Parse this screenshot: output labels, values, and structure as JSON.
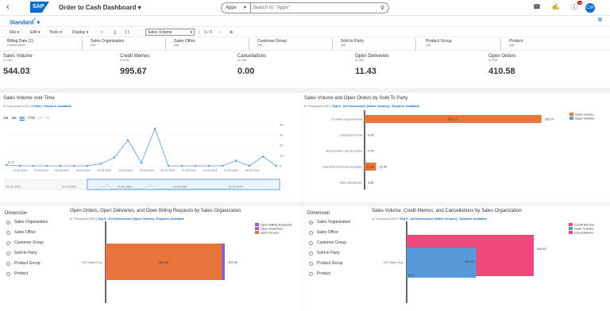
{
  "shell": {
    "back_icon": "back-chevron-icon",
    "logo": "SAP",
    "title": "Order to Cash Dashboard",
    "title_chevron": "▾",
    "search_scope": "Apps",
    "search_placeholder": "Search In: \"Apps\"",
    "notifications_count": "18",
    "avatar_initials": "CJP"
  },
  "variant": {
    "label": "Standard",
    "modified": "*"
  },
  "toolbar": {
    "file": "File",
    "edit": "Edit",
    "tools": "Tools",
    "display": "Display",
    "measure": "Sales Volume",
    "page": "1 / 3"
  },
  "filters": [
    {
      "label": "Billing Date (1)",
      "value": "Current Month"
    },
    {
      "label": "Sales Organization",
      "value": "(All)"
    },
    {
      "label": "Sales Office",
      "value": "(All)"
    },
    {
      "label": "Customer Group",
      "value": "(All)"
    },
    {
      "label": "Sold-to Party",
      "value": "(All)"
    },
    {
      "label": "Product Group",
      "value": "(All)"
    },
    {
      "label": "Product",
      "value": "(All)"
    }
  ],
  "kpis": [
    {
      "title": "Sales Volume",
      "unit": "In USD",
      "value": "544.03"
    },
    {
      "title": "Credit Memos",
      "unit": "In USD",
      "value": "995.67"
    },
    {
      "title": "Cancellations",
      "unit": "In USD",
      "value": "0.00"
    },
    {
      "title": "Open Deliveries",
      "unit": "In USD",
      "value": "11.43"
    },
    {
      "title": "Open Orders",
      "unit": "In USD",
      "value": "410.58"
    }
  ],
  "line_card": {
    "title": "Sales Volume over Time",
    "unit": "In Thousand USD",
    "filter_link": "1 Filter",
    "explorer_link": "Explorer Available",
    "ranges": [
      "1M",
      "3M",
      "6M",
      "YTD",
      "1Y",
      "All"
    ]
  },
  "bar_card": {
    "title": "Sales Volume and Open Orders by Sold-To Party",
    "unit": "In Thousand USD",
    "top_link": "Top 5 - All Dimensions (Sales Volume)",
    "explorer_link": "Explorer Available"
  },
  "dimension_left": {
    "title": "Dimension",
    "options": [
      "Sales Organization",
      "Sales Office",
      "Customer Group",
      "Sold-to Party",
      "Product Group",
      "Product"
    ],
    "selected": 0
  },
  "open_card": {
    "title": "Open Orders, Open Deliveries, and Open Billing Requests by Sales Organization",
    "unit": "In Thousand USD",
    "top_link": "Top 5 - All Dimensions (Open Orders)",
    "explorer_link": "Explorer Available"
  },
  "dimension_right": {
    "title": "Dimension",
    "options": [
      "Sales Organization",
      "Sales Office",
      "Customer Group",
      "Sold-to Party",
      "Product Group",
      "Product"
    ],
    "selected": 0
  },
  "credit_card": {
    "title": "Sales Volume, Credit Memos, and Cancellations by Sales Organization",
    "unit": "In Thousand USD",
    "top_link": "Top 5 - All Dimensions (Sales Volume)",
    "explorer_link": "Explorer Available"
  },
  "colors": {
    "brand": "#0a6ed1",
    "line": "#5899da",
    "orange": "#e8743b",
    "purple": "#945ecf",
    "red": "#ed4a7b",
    "blue": "#5899da"
  },
  "chart_data": [
    {
      "type": "line",
      "x": [
        "12.03.2024",
        "19.03.2024",
        "26.03.2024",
        "02.04.2024",
        "09.04.2024",
        "16.04.2024",
        "23.04.2024",
        "30.04.2024",
        "07.05.2024",
        "14.05.2024",
        "21.05.2024",
        "28.05.2024",
        "04.06.2024",
        "11.06.2024",
        "18.06.2024",
        "25.06.2024",
        "02.07.2024",
        "09.07.2024",
        "16.07.2024",
        "23.07.2024",
        "30.07.2024"
      ],
      "series": [
        {
          "values": [
            0.77,
            0,
            0,
            0,
            0,
            0,
            0,
            2,
            8,
            25,
            3,
            36,
            0,
            0,
            0,
            0,
            0,
            5,
            0,
            9,
            0
          ]
        }
      ],
      "xticks": [
        "12.03.2024",
        "19.03.2024",
        "26.03.2024",
        "02.04.2024",
        "09.04.2024",
        "16.04.2024",
        "23.04.2024",
        "30.04.2024",
        "07.05.2024",
        "14.05.2024",
        "21.05.2024",
        "28.05.2024"
      ],
      "ylim": [
        0,
        40
      ],
      "yticks": [
        "0",
        "10",
        "20",
        "30",
        "40"
      ],
      "point_label": "0.77",
      "range_dates": [
        "01.01.2024",
        "01.03.2024",
        "01.05.2024",
        "01.06.2024",
        "01.07.2024"
      ]
    },
    {
      "type": "bar",
      "categories": [
        "Crowley Supermarket",
        "Coloradd Foods",
        "Blacksmith Coal Supplies",
        "Diamond Electrical Supplies",
        "Nika Wholesale"
      ],
      "series": [
        {
          "name": "Open Orders",
          "values": [
            332.15,
            0,
            0,
            21.44,
            0
          ]
        },
        {
          "name": "Sales Volume",
          "values": [
            332.47,
            0.5,
            0.0,
            21.44,
            3.8
          ]
        }
      ],
      "labels": [
        "332.15",
        "332.47",
        "0.50",
        "0.00",
        "21.44",
        "21.44",
        "3.80"
      ],
      "xlim": [
        0,
        340
      ]
    },
    {
      "type": "bar",
      "categories": [
        "GB Sales Org."
      ],
      "series": [
        {
          "name": "Open Billing Requests",
          "values": [
            0
          ]
        },
        {
          "name": "Open Deliveries",
          "values": [
            11.43
          ]
        },
        {
          "name": "Open Orders",
          "values": [
            410.58
          ]
        }
      ],
      "labels": [
        "410.58",
        "422.32"
      ],
      "stacked": true
    },
    {
      "type": "bar",
      "categories": [
        "GB Sales Org."
      ],
      "series": [
        {
          "name": "Credit Memos",
          "values": [
            995.67
          ]
        },
        {
          "name": "Sales Volume",
          "values": [
            544.03
          ]
        },
        {
          "name": "Cancellations",
          "values": [
            0.0
          ]
        }
      ],
      "labels": [
        "995.67",
        "544.03",
        "0.00"
      ]
    }
  ]
}
